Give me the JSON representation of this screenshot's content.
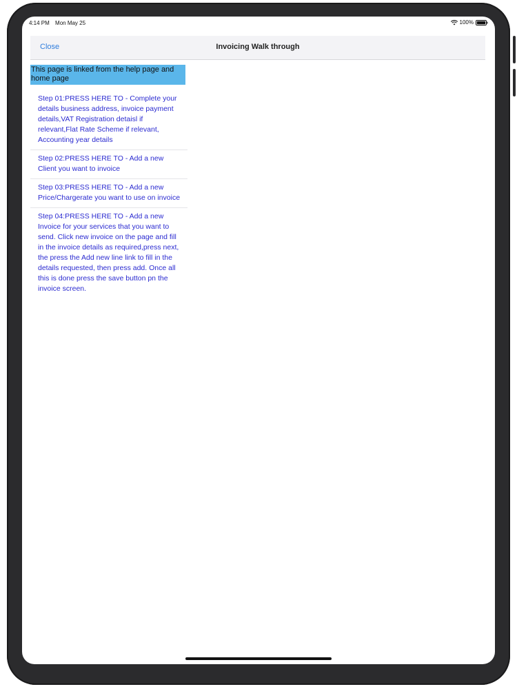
{
  "status_bar": {
    "time": "4:14 PM",
    "date": "Mon May 25",
    "battery": "100%"
  },
  "nav": {
    "close_label": "Close",
    "title": "Invoicing Walk through"
  },
  "banner": "This page is linked from the help page and home page",
  "steps": [
    "Step 01:PRESS HERE TO - Complete your details business address, invoice payment details,VAT Registration detaisl if relevant,Flat Rate Scheme if relevant, Accounting year details",
    "Step 02:PRESS HERE TO -  Add a new Client you want to invoice",
    "Step 03:PRESS HERE TO -  Add a new Price/Chargerate you want to use on invoice",
    "Step 04:PRESS HERE TO -  Add a new Invoice for your services that you want to send. Click new invoice on the page and fill in the invoice details as required,press next, the  press the Add new line link to fill in the details requested, then press add. Once all this is done press the save button pn the invoice screen."
  ],
  "colors": {
    "link_blue": "#2f7ddd",
    "step_text": "#2a2ad0",
    "banner_bg": "#5ab6ea"
  },
  "icons": [
    "wifi-icon",
    "battery-icon"
  ]
}
